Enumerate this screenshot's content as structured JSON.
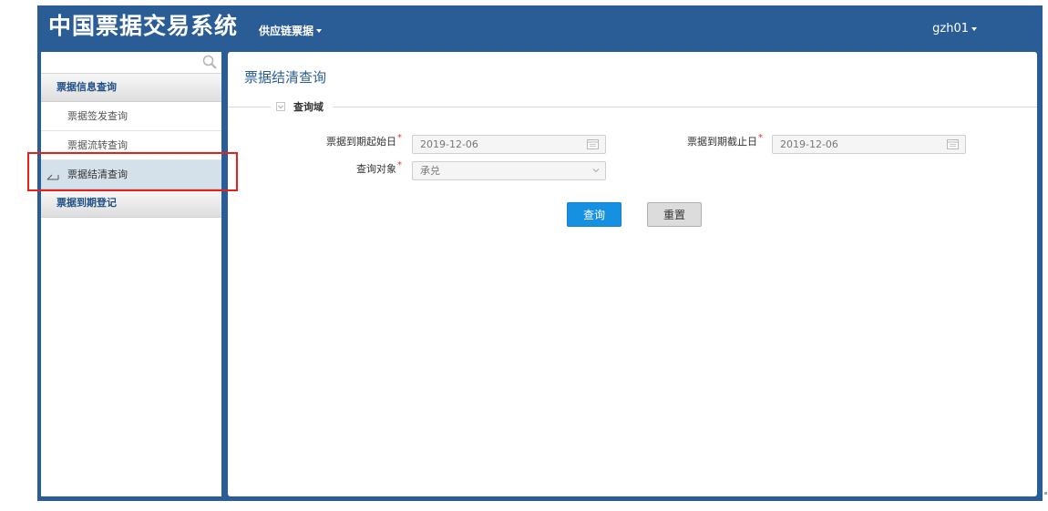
{
  "header": {
    "app_title": "中国票据交易系统",
    "nav_menu_label": "供应链票据",
    "user_label": "gzh01"
  },
  "sidebar": {
    "search": {
      "value": "",
      "placeholder": ""
    },
    "groups": [
      {
        "label": "票据信息查询",
        "items": [
          {
            "label": "票据签发查询",
            "active": false
          },
          {
            "label": "票据流转查询",
            "active": false
          },
          {
            "label": "票据结清查询",
            "active": true
          }
        ]
      },
      {
        "label": "票据到期登记",
        "items": []
      }
    ]
  },
  "main": {
    "page_title": "票据结清查询",
    "section_legend": "查询域",
    "form": {
      "start_date": {
        "label": "票据到期起始日",
        "required_mark": "*",
        "value": "2019-12-06"
      },
      "end_date": {
        "label": "票据到期截止日",
        "required_mark": "*",
        "value": "2019-12-06"
      },
      "target": {
        "label": "查询对象",
        "required_mark": "*",
        "value": "承兑"
      }
    },
    "buttons": {
      "query": "查询",
      "reset": "重置"
    }
  },
  "colors": {
    "header_bg": "#2a5d96",
    "primary_button": "#1690e0",
    "highlight_border": "#e8201a",
    "active_item_bg": "#d4e0ea"
  },
  "icons": [
    "search-icon",
    "chevron-down-icon",
    "calendar-icon",
    "collapse-toggle-icon",
    "active-item-marker-icon"
  ]
}
